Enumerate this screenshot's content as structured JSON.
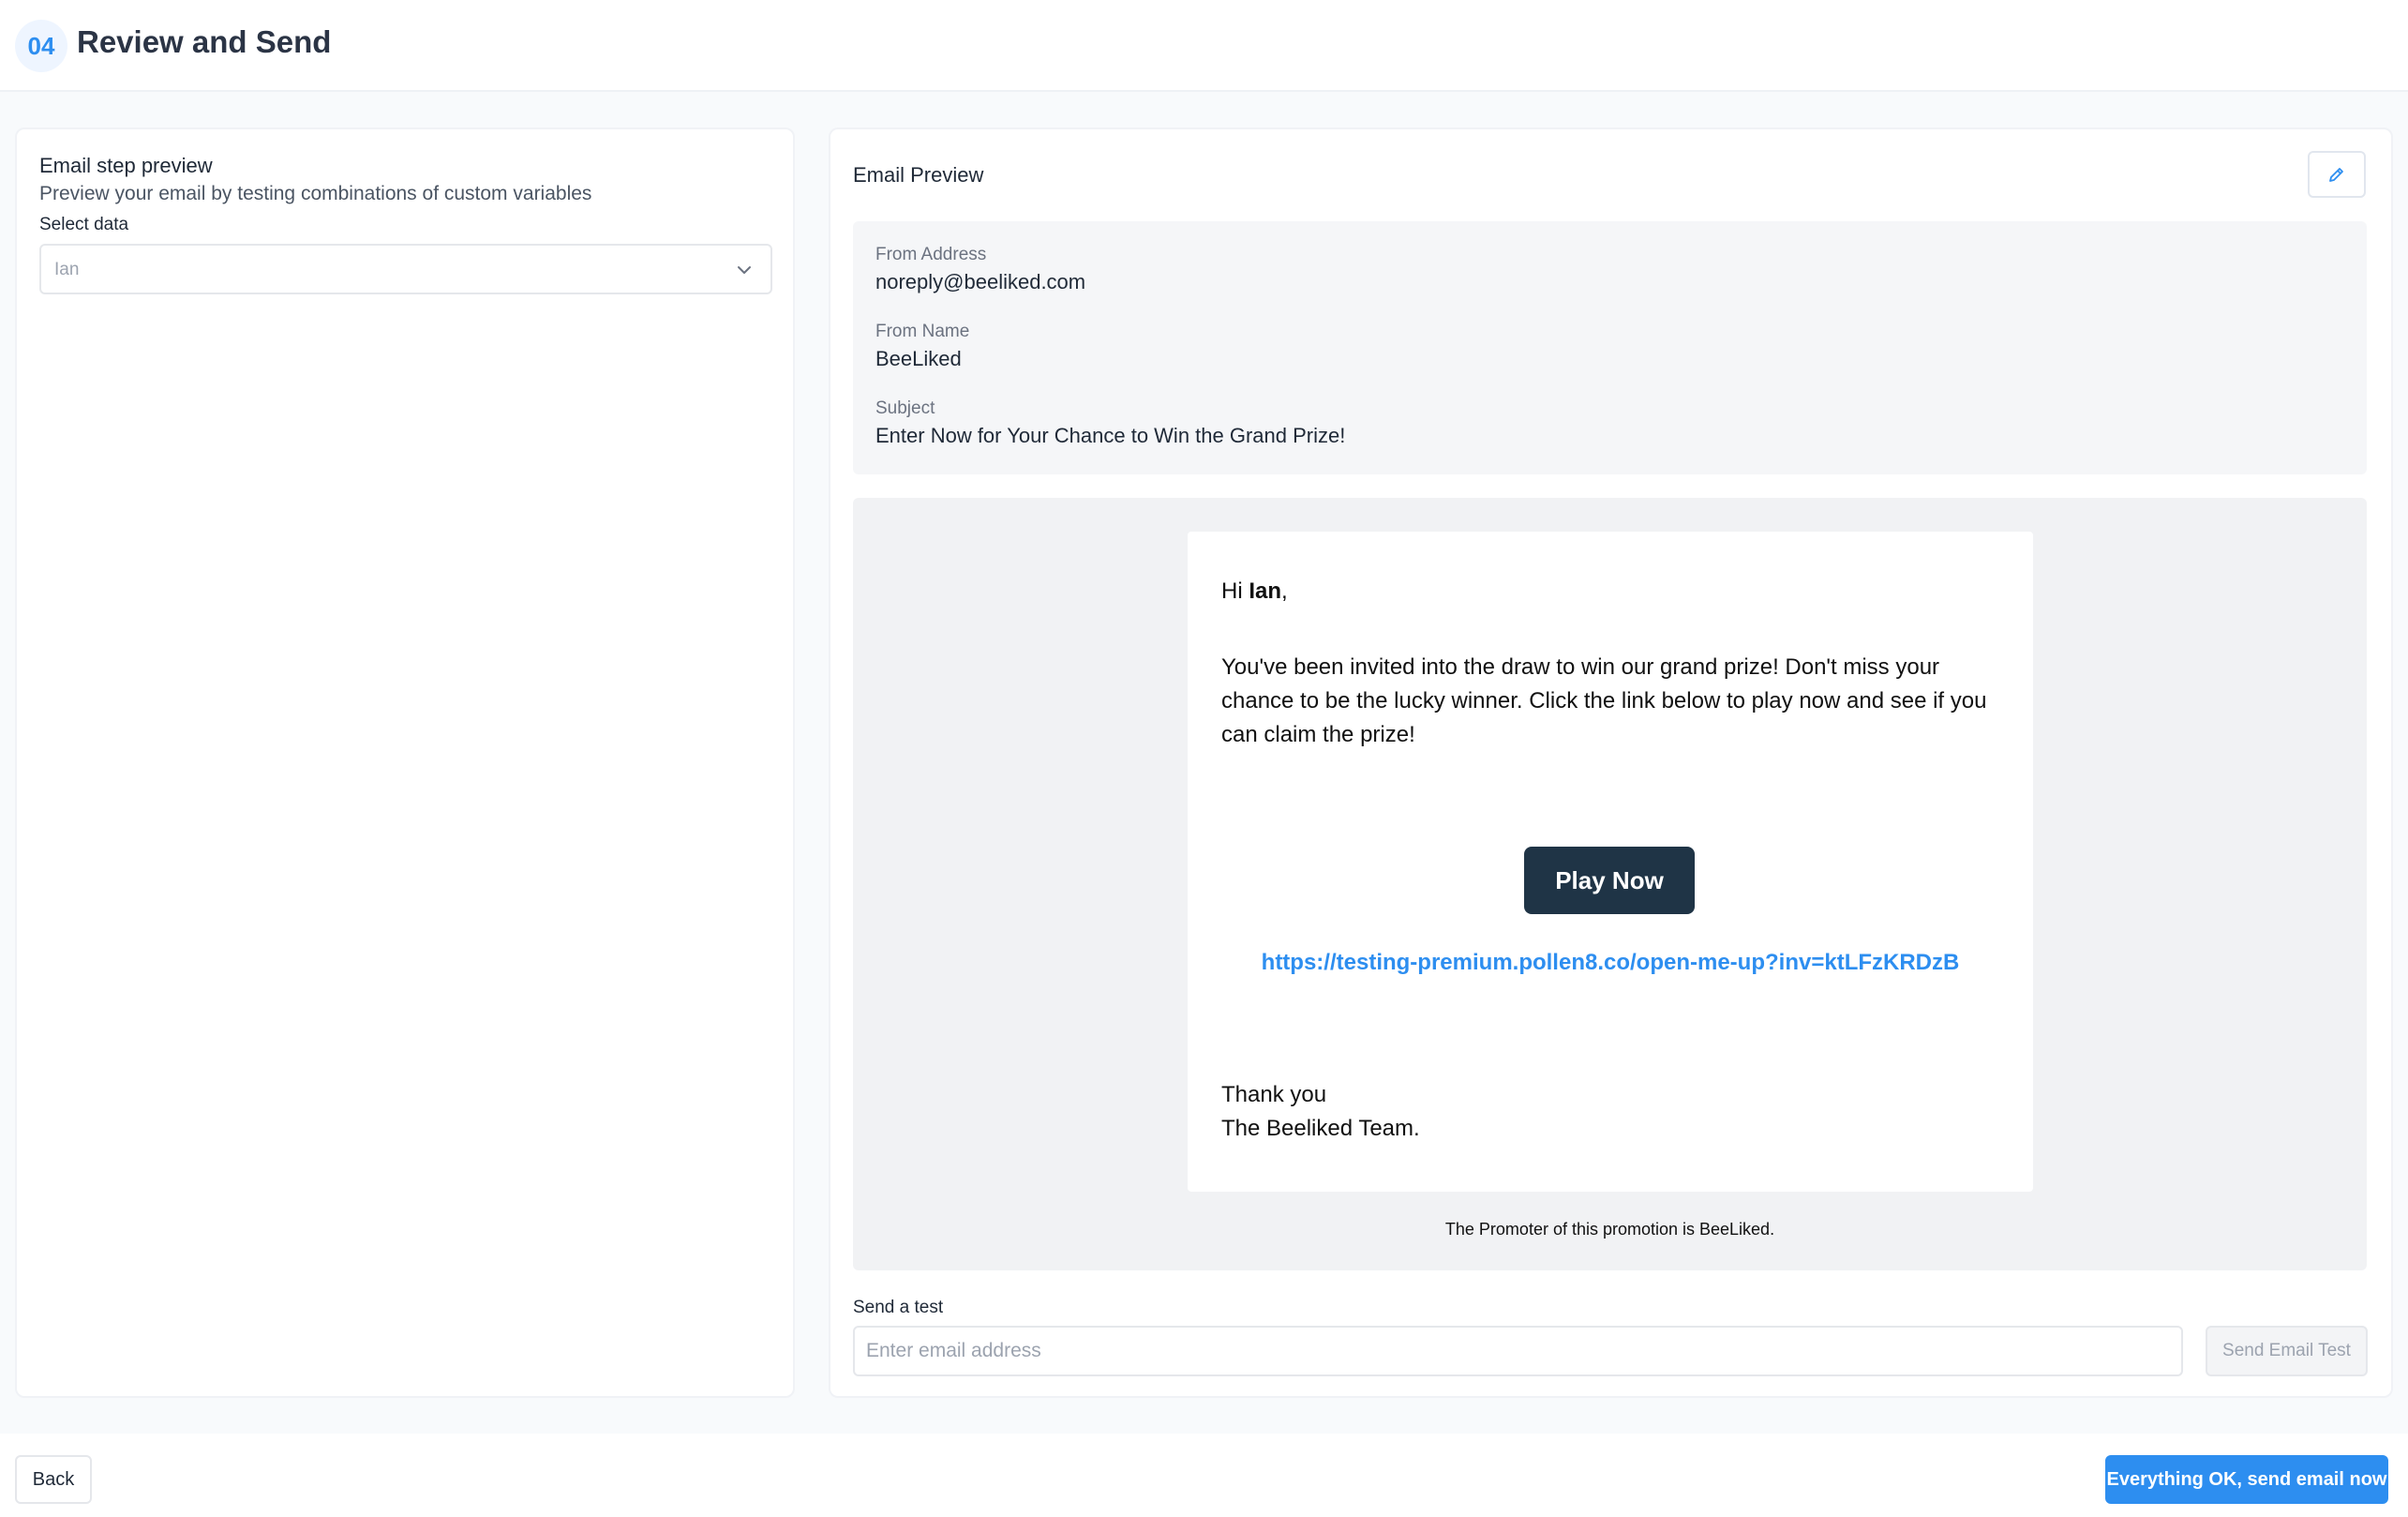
{
  "header": {
    "step_number": "04",
    "title": "Review and Send"
  },
  "left_panel": {
    "title": "Email step preview",
    "subtitle": "Preview your email by testing combinations of custom variables",
    "select_label": "Select data",
    "select_value": "Ian"
  },
  "right_panel": {
    "title": "Email Preview",
    "edit_icon": "pencil-icon",
    "meta": {
      "from_address_label": "From Address",
      "from_address_value": "noreply@beeliked.com",
      "from_name_label": "From Name",
      "from_name_value": "BeeLiked",
      "subject_label": "Subject",
      "subject_value": "Enter Now for Your Chance to Win the Grand Prize!"
    },
    "email": {
      "greeting_prefix": "Hi ",
      "recipient_name": "Ian",
      "greeting_suffix": ",",
      "body": "You've been invited into the draw to win our grand prize! Don't miss your chance to be the lucky winner. Click the link below to play now and see if you can claim the prize!",
      "cta_label": "Play Now",
      "link": "https://testing-premium.pollen8.co/open-me-up?inv=ktLFzKRDzB",
      "signoff_line1": "Thank you",
      "signoff_line2": "The Beeliked Team."
    },
    "promoter_text": "The Promoter of this promotion is BeeLiked.",
    "send_test": {
      "label": "Send a test",
      "placeholder": "Enter email address",
      "button_label": "Send Email Test"
    }
  },
  "footer": {
    "back_label": "Back",
    "send_label": "Everything OK, send email now"
  },
  "colors": {
    "accent": "#2d8ef0",
    "cta_dark": "#1f3446"
  }
}
